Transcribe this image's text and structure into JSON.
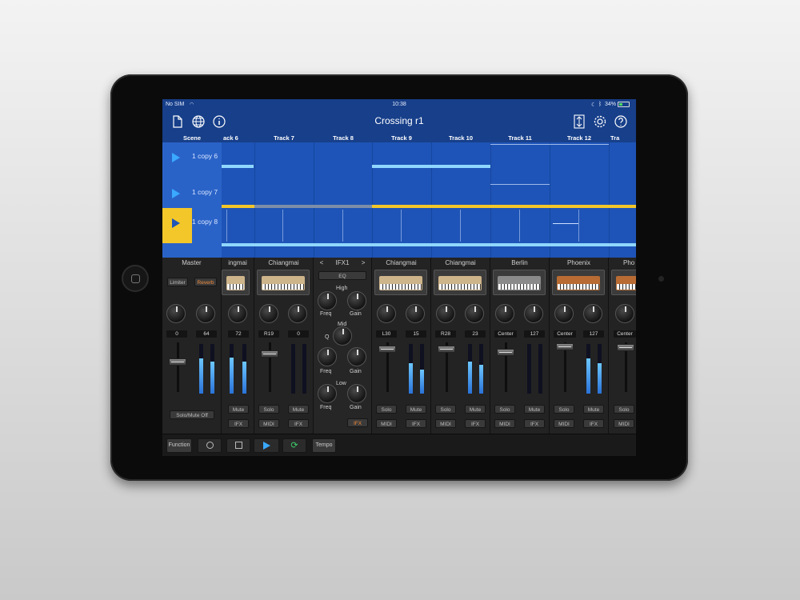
{
  "status": {
    "carrier": "No SIM",
    "time": "10:38",
    "battery": "34%"
  },
  "nav": {
    "title": "Crossing r1",
    "icons": [
      "document-icon",
      "globe-icon",
      "info-icon",
      "expand-icon",
      "gear-icon",
      "help-icon"
    ]
  },
  "tracks": {
    "scene_label": "Scene",
    "headers": [
      "ack 6",
      "Track 7",
      "Track 8",
      "Track 9",
      "Track 10",
      "Track 11",
      "Track 12",
      "Tra"
    ]
  },
  "scenes": [
    {
      "label": "1 copy 6",
      "active": false
    },
    {
      "label": "1 copy 7",
      "active": false
    },
    {
      "label": "1 copy 8",
      "active": true
    }
  ],
  "mixer": {
    "master": {
      "name": "Master",
      "limiter": "Limiter",
      "reverb": "Reverb",
      "val1": "0",
      "val2": "64",
      "solo_mute_off": "Solo/Mute Off"
    },
    "strips": [
      {
        "name": "ingmai",
        "val1": "72",
        "val2": "",
        "solo": "",
        "mute": "Mute",
        "midi": "",
        "ifx": "IFX",
        "thumb": "tan"
      },
      {
        "name": "Chiangmai",
        "val1": "R19",
        "val2": "0",
        "solo": "Solo",
        "mute": "Mute",
        "midi": "MIDI",
        "ifx": "IFX",
        "thumb": "tan"
      },
      {
        "name": "Chiangmai",
        "val1": "L30",
        "val2": "15",
        "solo": "Solo",
        "mute": "Mute",
        "midi": "MIDI",
        "ifx": "IFX",
        "thumb": "tan"
      },
      {
        "name": "Chiangmai",
        "val1": "R28",
        "val2": "23",
        "solo": "Solo",
        "mute": "Mute",
        "midi": "MIDI",
        "ifx": "IFX",
        "thumb": "tan"
      },
      {
        "name": "Berlin",
        "val1": "Center",
        "val2": "127",
        "solo": "Solo",
        "mute": "Mute",
        "midi": "MIDI",
        "ifx": "IFX",
        "thumb": "gray"
      },
      {
        "name": "Phoenix",
        "val1": "Center",
        "val2": "127",
        "solo": "Solo",
        "mute": "Mute",
        "midi": "MIDI",
        "ifx": "IFX",
        "thumb": "orange"
      },
      {
        "name": "Pho",
        "val1": "Center",
        "val2": "",
        "solo": "Solo",
        "mute": "",
        "midi": "MIDI",
        "ifx": "",
        "thumb": "orange"
      }
    ],
    "ifx": {
      "prev": "<",
      "name": "IFX1",
      "next": ">",
      "eq": "EQ",
      "high": "High",
      "mid": "Mid",
      "low": "Low",
      "freq": "Freq",
      "gain": "Gain",
      "q": "Q",
      "ifx_button": "IFX"
    }
  },
  "toolbar": {
    "function": "Function",
    "tempo": "Tempo",
    "record_icon": "circle-icon",
    "stop_icon": "square-icon",
    "play_icon": "play-icon",
    "loop_icon": "loop-icon"
  },
  "colors": {
    "nav_blue": "#173f8a",
    "grid_blue": "#1e54b7",
    "highlight_yellow": "#f3c72a",
    "light_blue": "#8fd7ff",
    "play_blue": "#3aa9ff",
    "loop_green": "#3ccf6a",
    "orange": "#f08a3a"
  }
}
